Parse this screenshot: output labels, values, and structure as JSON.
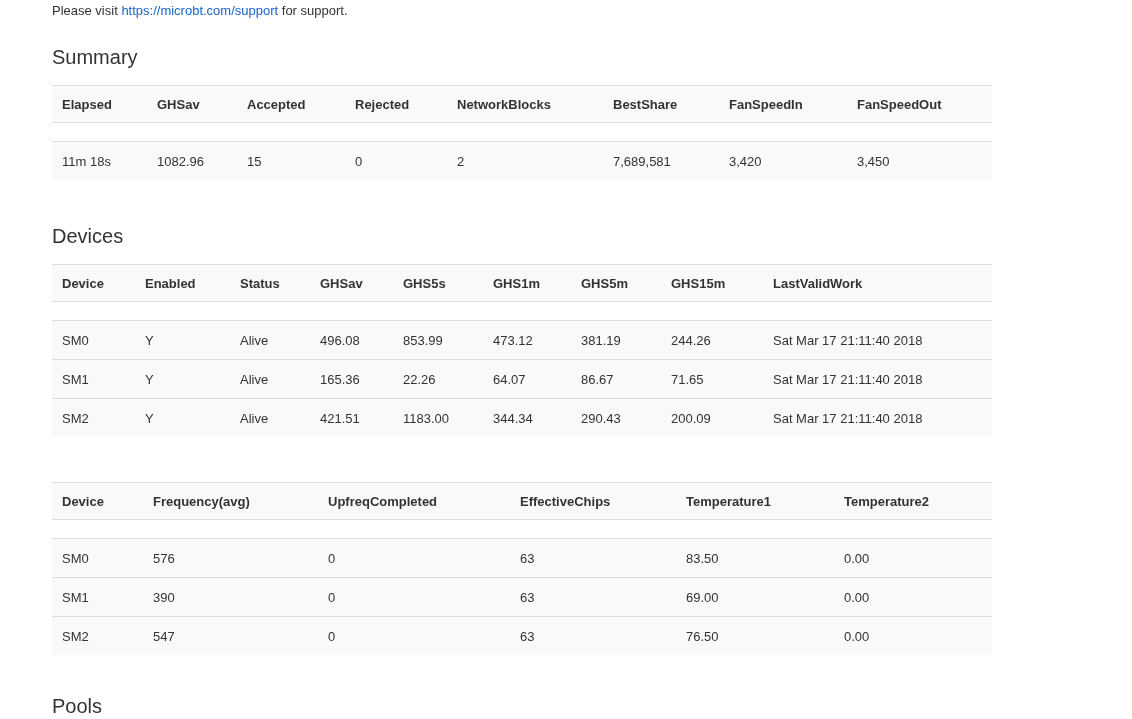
{
  "notice": {
    "before": "Please visit ",
    "link": "https://microbt.com/support",
    "after": " for support."
  },
  "sections": [
    {
      "title": "Summary",
      "tables": [
        {
          "columns": [
            "Elapsed",
            "GHSav",
            "Accepted",
            "Rejected",
            "NetworkBlocks",
            "BestShare",
            "FanSpeedIn",
            "FanSpeedOut"
          ],
          "rows": [
            [
              "11m 18s",
              "1082.96",
              "15",
              "0",
              "2",
              "7,689,581",
              "3,420",
              "3,450"
            ]
          ]
        }
      ]
    },
    {
      "title": "Devices",
      "tables": [
        {
          "columns": [
            "Device",
            "Enabled",
            "Status",
            "GHSav",
            "GHS5s",
            "GHS1m",
            "GHS5m",
            "GHS15m",
            "LastValidWork"
          ],
          "rows": [
            [
              "SM0",
              "Y",
              "Alive",
              "496.08",
              "853.99",
              "473.12",
              "381.19",
              "244.26",
              "Sat Mar 17 21:11:40 2018"
            ],
            [
              "SM1",
              "Y",
              "Alive",
              "165.36",
              "22.26",
              "64.07",
              "86.67",
              "71.65",
              "Sat Mar 17 21:11:40 2018"
            ],
            [
              "SM2",
              "Y",
              "Alive",
              "421.51",
              "1183.00",
              "344.34",
              "290.43",
              "200.09",
              "Sat Mar 17 21:11:40 2018"
            ]
          ]
        },
        {
          "columns": [
            "Device",
            "Frequency(avg)",
            "UpfreqCompleted",
            "EffectiveChips",
            "Temperature1",
            "Temperature2"
          ],
          "rows": [
            [
              "SM0",
              "576",
              "0",
              "63",
              "83.50",
              "0.00"
            ],
            [
              "SM1",
              "390",
              "0",
              "63",
              "69.00",
              "0.00"
            ],
            [
              "SM2",
              "547",
              "0",
              "63",
              "76.50",
              "0.00"
            ]
          ]
        }
      ]
    },
    {
      "title": "Pools"
    }
  ]
}
